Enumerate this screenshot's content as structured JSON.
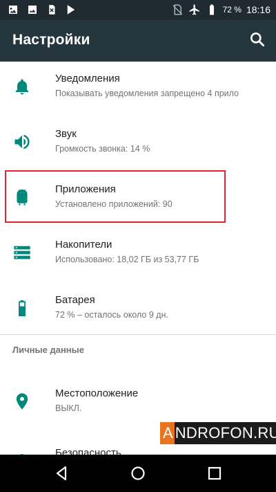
{
  "status_bar": {
    "battery_percent": "72 %",
    "time": "18:16",
    "left_icons": [
      "photo-icon",
      "image-icon",
      "sim-x-icon",
      "play-store-icon"
    ],
    "right_icons": [
      "no-sim-icon",
      "airplane-icon",
      "battery-icon"
    ]
  },
  "app_bar": {
    "title": "Настройки",
    "search_icon": "search-icon"
  },
  "settings": [
    {
      "title": "Уведомления",
      "subtitle": "Показывать уведомления запрещено 4 прило",
      "icon": "bell-icon"
    },
    {
      "title": "Звук",
      "subtitle": "Громкость звонка: 14 %",
      "icon": "volume-icon"
    },
    {
      "title": "Приложения",
      "subtitle": "Установлено приложений: 90",
      "icon": "android-icon"
    },
    {
      "title": "Накопители",
      "subtitle": "Использовано: 18,02 ГБ из 53,77 ГБ",
      "icon": "storage-icon"
    },
    {
      "title": "Батарея",
      "subtitle": "72 % – осталось около 9 дн.",
      "icon": "battery-icon"
    }
  ],
  "personal": {
    "header": "Личные данные",
    "items": [
      {
        "title": "Местоположение",
        "subtitle": "ВЫКЛ.",
        "icon": "location-icon"
      },
      {
        "title": "Безопасность",
        "icon": "lock-icon"
      }
    ]
  },
  "watermark": {
    "first": "A",
    "rest": "NDROFON.RU"
  },
  "navigation": [
    "back-icon",
    "home-icon",
    "recents-icon"
  ],
  "colors": {
    "accent": "#00897b",
    "appbar": "#26363d",
    "statusbar": "#1f2b30",
    "highlight": "#e0232e"
  }
}
